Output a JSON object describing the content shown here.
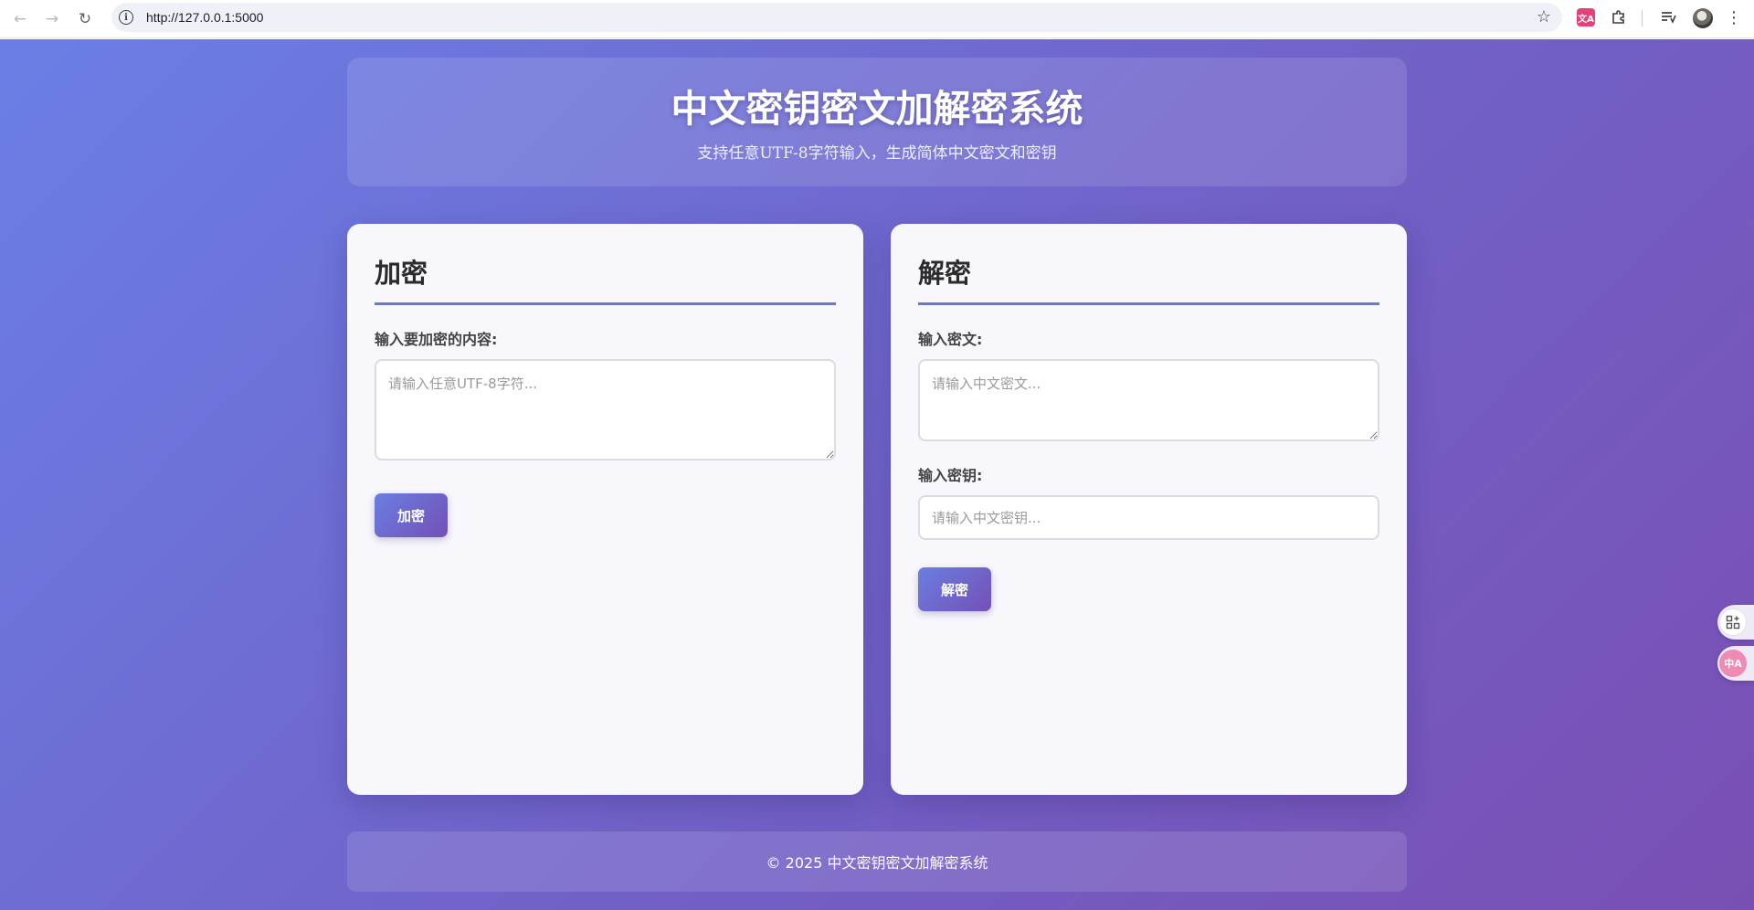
{
  "browser": {
    "url": "http://127.0.0.1:5000",
    "icons": [
      "back-arrow-icon",
      "forward-arrow-icon",
      "reload-icon",
      "site-info-icon",
      "bookmark-star-icon",
      "translate-extension-icon",
      "extensions-puzzle-icon",
      "reading-list-icon",
      "profile-avatar",
      "more-menu-icon"
    ]
  },
  "header": {
    "title": "中文密钥密文加解密系统",
    "subtitle": "支持任意UTF-8字符输入，生成简体中文密文和密钥"
  },
  "encrypt_panel": {
    "title": "加密",
    "input_label": "输入要加密的内容:",
    "input_placeholder": "请输入任意UTF-8字符...",
    "input_value": "",
    "button_label": "加密"
  },
  "decrypt_panel": {
    "title": "解密",
    "ciphertext_label": "输入密文:",
    "ciphertext_placeholder": "请输入中文密文...",
    "ciphertext_value": "",
    "key_label": "输入密钥:",
    "key_placeholder": "请输入中文密钥...",
    "key_value": "",
    "button_label": "解密"
  },
  "footer": {
    "text": "© 2025 中文密钥密文加解密系统"
  },
  "side_widgets": {
    "translate_badge": "中A"
  },
  "colors": {
    "gradient_start": "#6a7fe6",
    "gradient_end": "#7a4fb4",
    "panel_bg": "#f7f7fc",
    "accent_underline": "#6877d8"
  }
}
